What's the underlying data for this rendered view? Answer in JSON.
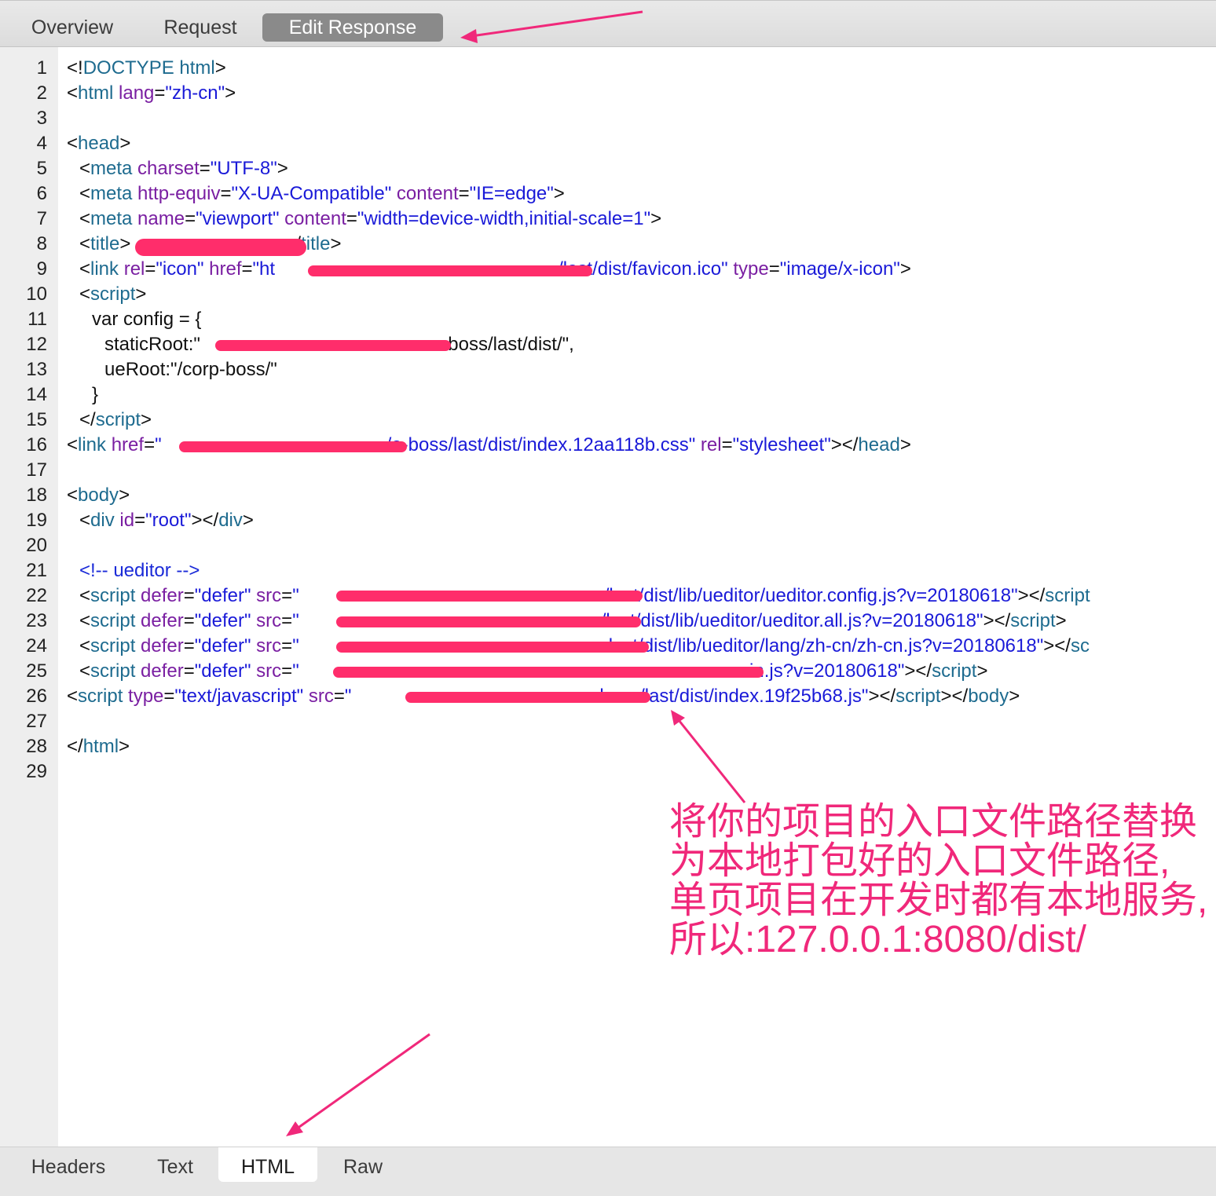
{
  "top_tabs": {
    "overview": "Overview",
    "request": "Request",
    "edit_response": "Edit Response"
  },
  "line_numbers": [
    "1",
    "2",
    "3",
    "4",
    "5",
    "6",
    "7",
    "8",
    "9",
    "10",
    "11",
    "12",
    "13",
    "14",
    "15",
    "16",
    "17",
    "18",
    "19",
    "20",
    "21",
    "22",
    "23",
    "24",
    "25",
    "26",
    "27",
    "28",
    "29"
  ],
  "code": {
    "l1": {
      "a": "<!",
      "b": "DOCTYPE html",
      "c": ">"
    },
    "l2": {
      "a": "<",
      "b": "html",
      "c": " lang",
      "d": "=",
      "e": "\"zh-cn\"",
      "f": ">"
    },
    "l4": {
      "a": "<",
      "b": "head",
      "c": ">"
    },
    "l5": {
      "a": "<",
      "b": "meta",
      "c": " charset",
      "d": "=",
      "e": "\"UTF-8\"",
      "f": ">"
    },
    "l6": {
      "a": "<",
      "b": "meta",
      "c": " http-equiv",
      "d": "=",
      "e": "\"X-UA-Compatible\"",
      "f": " content",
      "g": "=",
      "h": "\"IE=edge\"",
      "i": ">"
    },
    "l7": {
      "a": "<",
      "b": "meta",
      "c": " name",
      "d": "=",
      "e": "\"viewport\"",
      "f": " content",
      "g": "=",
      "h": "\"width=device-width,initial-scale=1\"",
      "i": ">"
    },
    "l8": {
      "a": "<",
      "b": "title",
      "c": ">",
      "d": "</",
      "e": "title",
      "f": ">"
    },
    "l9": {
      "a": "<",
      "b": "link",
      "c": " rel",
      "d": "=",
      "e": "\"icon\"",
      "f": " href",
      "g": "=",
      "h": "\"ht",
      "i": "/last/dist/favicon.ico\"",
      "j": " type",
      "k": "=",
      "l": "\"image/x-icon\"",
      "m": ">"
    },
    "l10": {
      "a": "<",
      "b": "script",
      "c": ">"
    },
    "l11": "var config = {",
    "l12": {
      "a": "staticRoot:\"",
      "b": "e-boss/last/dist/\","
    },
    "l13": "ueRoot:\"/corp-boss/\"",
    "l14": "}",
    "l15": {
      "a": "</",
      "b": "script",
      "c": ">"
    },
    "l16": {
      "a": "<",
      "b": "link",
      "c": " href",
      "d": "=",
      "e": "\"",
      "f": "/e-boss/last/dist/index.12aa118b.css\"",
      "g": " rel",
      "h": "=",
      "i": "\"stylesheet\"",
      "j": "></",
      "k": "head",
      "l": ">"
    },
    "l18": {
      "a": "<",
      "b": "body",
      "c": ">"
    },
    "l19": {
      "a": "<",
      "b": "div",
      "c": " id",
      "d": "=",
      "e": "\"root\"",
      "f": "></",
      "g": "div",
      "h": ">"
    },
    "l21": "<!-- ueditor -->",
    "l22": {
      "a": "<",
      "b": "script",
      "c": " defer",
      "d": "=",
      "e": "\"defer\"",
      "f": " src",
      "g": "=",
      "h": "\"",
      "i": "/last/dist/lib/ueditor/ueditor.config.js?v=20180618\"",
      "j": "></",
      "k": "script"
    },
    "l23": {
      "a": "<",
      "b": "script",
      "c": " defer",
      "d": "=",
      "e": "\"defer\"",
      "f": " src",
      "g": "=",
      "h": "\"",
      "i": "/last/dist/lib/ueditor/ueditor.all.js?v=20180618\"",
      "j": "></",
      "k": "script",
      "l": ">"
    },
    "l24": {
      "a": "<",
      "b": "script",
      "c": " defer",
      "d": "=",
      "e": "\"defer\"",
      "f": " src",
      "g": "=",
      "h": "\"",
      "i": "last/dist/lib/ueditor/lang/zh-cn/zh-cn.js?v=20180618\"",
      "j": "></",
      "k": "sc"
    },
    "l25": {
      "a": "<",
      "b": "script",
      "c": " defer",
      "d": "=",
      "e": "\"defer\"",
      "f": " src",
      "g": "=",
      "h": "\"",
      "i": "r.min.js?v=20180618\"",
      "j": "></",
      "k": "script",
      "l": ">"
    },
    "l26": {
      "a": "<",
      "b": "script",
      "c": " type",
      "d": "=",
      "e": "\"text/javascript\"",
      "f": " src",
      "g": "=",
      "h": "\"",
      "i": "-boss/last/dist/index.19f25b68.js\"",
      "j": "></",
      "k": "script",
      "l": "></",
      "m": "body",
      "n": ">"
    },
    "l28": {
      "a": "</",
      "b": "html",
      "c": ">"
    }
  },
  "annotation": {
    "line1": "将你的项目的入口文件路径替换",
    "line2": "为本地打包好的入口文件路径,",
    "line3": "单页项目在开发时都有本地服务,",
    "line4": "所以:127.0.0.1:8080/dist/"
  },
  "bottom_tabs": {
    "headers": "Headers",
    "text": "Text",
    "html": "HTML",
    "raw": "Raw"
  },
  "colors": {
    "annotation": "#f0287a",
    "redaction": "#ff2d6b",
    "tag": "#1e6b8f",
    "attr": "#7a1fa2",
    "string": "#1a1ad8"
  },
  "icons": [
    "arrow-to-edit-response",
    "arrow-to-script-src",
    "arrow-to-html-tab"
  ]
}
